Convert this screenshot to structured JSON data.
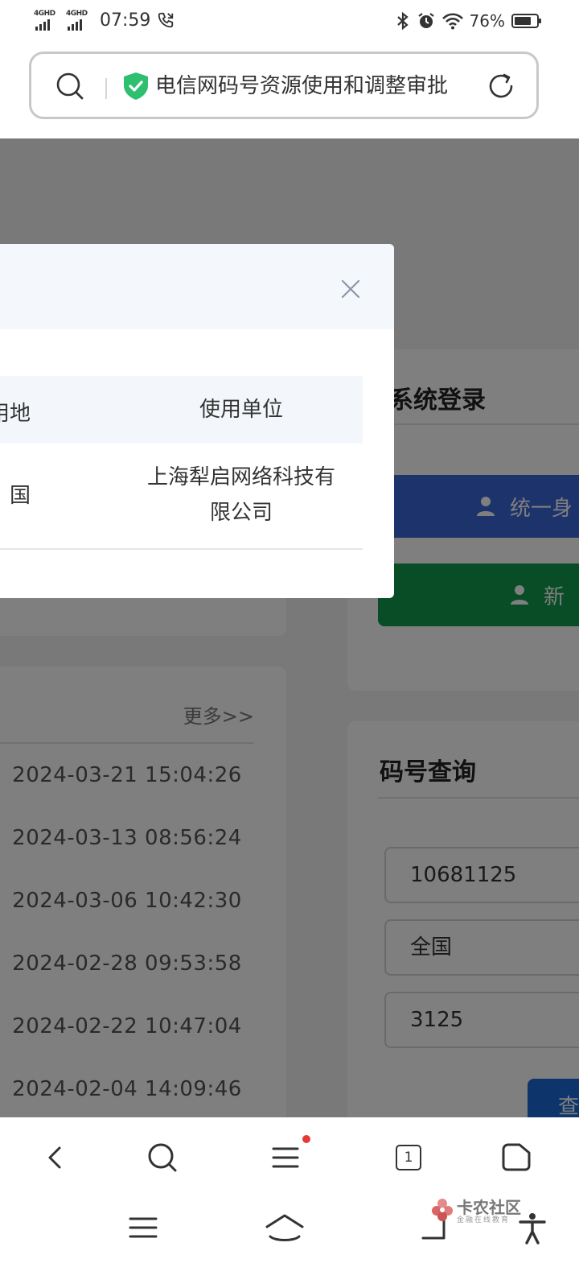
{
  "status_bar": {
    "network_1": "4GHD",
    "network_2": "4GHD",
    "time": "07:59",
    "battery_percent": "76%",
    "battery_level": 0.76
  },
  "address_bar": {
    "page_title": "电信网码号资源使用和调整审批"
  },
  "modal": {
    "table": {
      "headers": [
        "用地",
        "使用单位"
      ],
      "rows": [
        {
          "region": "国",
          "unit_line1": "上海犁启网络科技有",
          "unit_line2": "限公司"
        }
      ]
    }
  },
  "page": {
    "news": {
      "more_label": "更多>>",
      "dates": [
        "2024-03-21 15:04:26",
        "2024-03-13 08:56:24",
        "2024-03-06 10:42:30",
        "2024-02-28 09:53:58",
        "2024-02-22 10:47:04",
        "2024-02-04 14:09:46"
      ]
    },
    "login": {
      "title": "系统登录",
      "unified_button": "统一身",
      "new_button": "新"
    },
    "query": {
      "title": "码号查询",
      "number_value": "10681125",
      "region_value": "全国",
      "code_value": "3125",
      "button_label": "查"
    }
  },
  "toolbar": {
    "tab_count": "1"
  },
  "watermark": {
    "title": "卡农社区",
    "subtitle": "金融在线教育"
  }
}
